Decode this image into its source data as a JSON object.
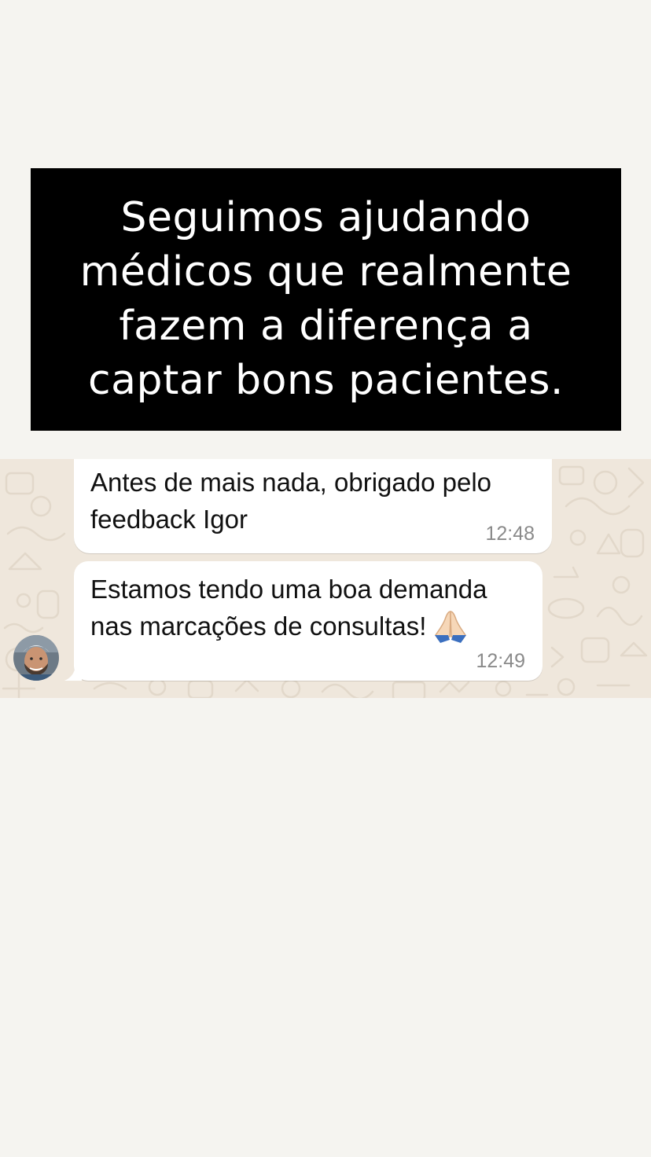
{
  "headline": {
    "text": "Seguimos ajudando\nmédicos que realmente\nfazem a diferença a\ncaptar bons pacientes."
  },
  "chat": {
    "messages": [
      {
        "text": "Antes de mais nada, obrigado pelo\nfeedback Igor",
        "time": "12:48"
      },
      {
        "text": "Estamos tendo uma boa demanda\nnas marcações de consultas!",
        "emoji": "folded-hands-icon",
        "time": "12:49"
      }
    ]
  },
  "colors": {
    "page_background": "#f5f4f0",
    "headline_background": "#000000",
    "headline_text": "#ffffff",
    "chat_background": "#efe7dc",
    "bubble_background": "#ffffff",
    "timestamp": "#8a8a8a"
  }
}
